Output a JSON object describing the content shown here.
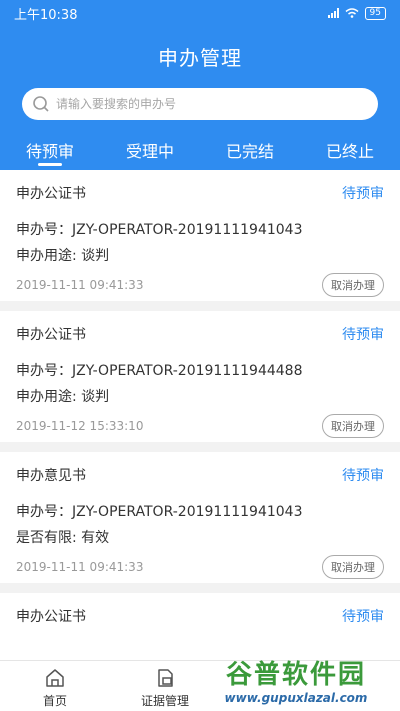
{
  "status_bar": {
    "time": "上午10:38",
    "battery": "95"
  },
  "header": {
    "title": "申办管理"
  },
  "search": {
    "placeholder": "请输入要搜索的申办号"
  },
  "tabs": [
    {
      "label": "待预审",
      "active": true
    },
    {
      "label": "受理中",
      "active": false
    },
    {
      "label": "已完结",
      "active": false
    },
    {
      "label": "已终止",
      "active": false
    }
  ],
  "records": [
    {
      "type": "申办公证书",
      "status": "待预审",
      "id_label": "申办号：",
      "id_value": "JZY-OPERATOR-20191111941043",
      "field_label": "申办用途:",
      "field_value": "谈判",
      "time": "2019-11-11 09:41:33",
      "action": "取消办理"
    },
    {
      "type": "申办公证书",
      "status": "待预审",
      "id_label": "申办号：",
      "id_value": "JZY-OPERATOR-20191111944488",
      "field_label": "申办用途:",
      "field_value": "谈判",
      "time": "2019-11-12 15:33:10",
      "action": "取消办理"
    },
    {
      "type": "申办意见书",
      "status": "待预审",
      "id_label": "申办号：",
      "id_value": "JZY-OPERATOR-20191111941043",
      "field_label": "是否有限:",
      "field_value": "有效",
      "time": "2019-11-11 09:41:33",
      "action": "取消办理"
    },
    {
      "type": "申办公证书",
      "status": "待预审"
    }
  ],
  "tabbar": [
    {
      "label": "首页",
      "icon": "home-icon"
    },
    {
      "label": "证据管理",
      "icon": "evidence-icon"
    }
  ],
  "watermark": {
    "title": "谷普软件园",
    "url": "www.gupuxlazal.com"
  },
  "colors": {
    "primary": "#2f8cf0",
    "watermark_green": "#3b9a3b"
  }
}
